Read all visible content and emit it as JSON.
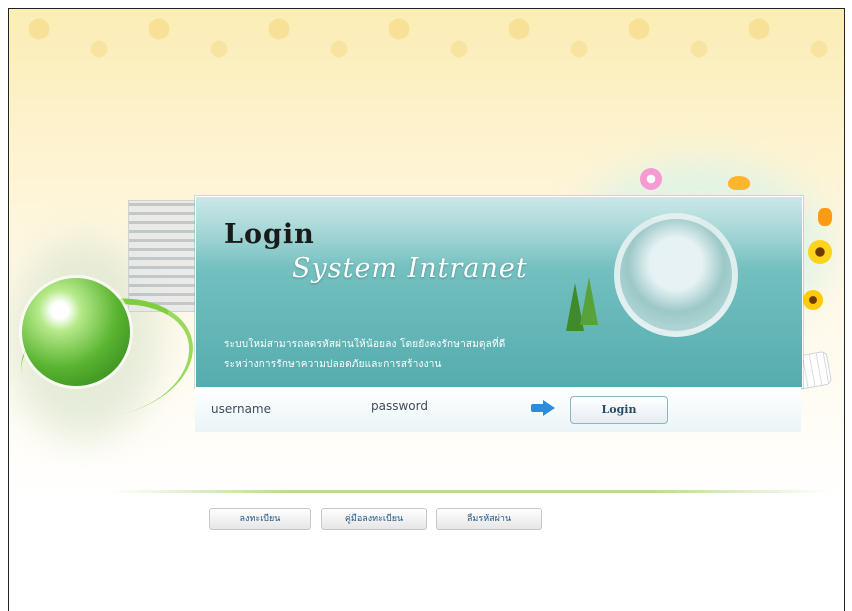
{
  "panel": {
    "title": "Login",
    "subtitle": "System Intranet",
    "description_line1": "ระบบใหม่สามารถลดรหัสผ่านให้น้อยลง โดยยังคงรักษาสมดุลที่ดี",
    "description_line2": "ระหว่างการรักษาความปลอดภัยและการสร้างงาน"
  },
  "login_bar": {
    "username_label": "username",
    "password_label": "password",
    "login_button": "Login"
  },
  "footer_buttons": [
    "ลงทะเบียน",
    "คู่มือลงทะเบียน",
    "ลืมรหัสผ่าน"
  ],
  "colors": {
    "panel_teal": "#72bfbf",
    "arrow_blue": "#2e8bdc",
    "link_blue": "#1f5580"
  }
}
